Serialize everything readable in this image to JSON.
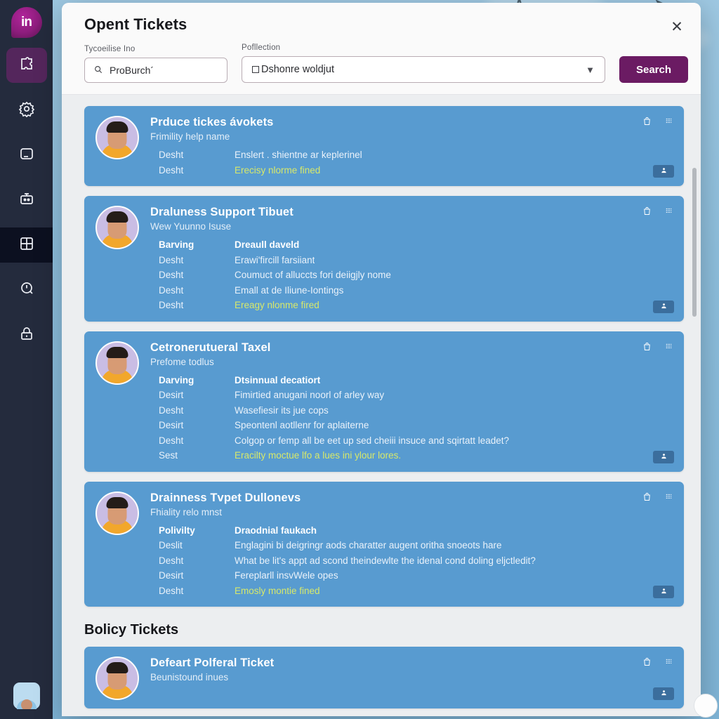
{
  "app": {
    "logo_text": "in",
    "logo_name": "app-logo"
  },
  "sidebar": {
    "items": [
      {
        "name": "puzzle-icon",
        "label": "Integrations"
      },
      {
        "name": "gear-icon",
        "label": "Settings"
      },
      {
        "name": "window-icon",
        "label": "Workspace"
      },
      {
        "name": "robot-icon",
        "label": "Bots"
      },
      {
        "name": "grid-icon",
        "label": "Dashboard"
      },
      {
        "name": "clock-icon",
        "label": "History"
      },
      {
        "name": "lock-icon",
        "label": "Security"
      }
    ],
    "avatar_name": "user-avatar"
  },
  "modal": {
    "title": "Opent Tickets",
    "close_label": "✕"
  },
  "search": {
    "query_label": "Tycoeilise Ino",
    "query_value": "ProBurch´",
    "query_placeholder": "ProBurch´",
    "filter_label": "Pofllection",
    "filter_value": "Dshonre woldjut",
    "filter_options": [
      "Dshonre woldjut"
    ],
    "button_label": "Search"
  },
  "sections": [
    {
      "heading": "",
      "tickets": [
        {
          "title": "Prduce tickes ávokets",
          "subtitle": "Frimility help name",
          "rows": [
            {
              "c1": "Desht",
              "c2": "Enslert . shientne ar keplerinel",
              "kind": "normal"
            },
            {
              "c1": "Desht",
              "c2": "Erecisy nlorme fined",
              "kind": "ok"
            }
          ]
        },
        {
          "title": "Draluness Support Tibuet",
          "subtitle": "Wew Yuunno Isuse",
          "rows": [
            {
              "c1": "Barving",
              "c2": "Dreaull daveld",
              "kind": "head"
            },
            {
              "c1": "Desht",
              "c2": "Erawi'fircill farsiiant",
              "kind": "normal"
            },
            {
              "c1": "Desht",
              "c2": "Coumuct of alluccts fori deiigjly nome",
              "kind": "normal"
            },
            {
              "c1": "Desht",
              "c2": "Emall at de Iliune-Iontings",
              "kind": "normal"
            },
            {
              "c1": "Desht",
              "c2": "Ereagy nlonme fired",
              "kind": "ok"
            }
          ]
        },
        {
          "title": "Cetronerutueral Taxel",
          "subtitle": "Prefome todlus",
          "rows": [
            {
              "c1": "Darving",
              "c2": "Dtsinnual decatiort",
              "kind": "head"
            },
            {
              "c1": "Desirt",
              "c2": "Fimirtied anugani noorl of arley way",
              "kind": "normal"
            },
            {
              "c1": "Desht",
              "c2": "Wasefiesir its jue cops",
              "kind": "normal"
            },
            {
              "c1": "Desirt",
              "c2": "Speontenl aotllenr for aplaiterne",
              "kind": "normal"
            },
            {
              "c1": "Desht",
              "c2": "Colgop or femp all be eet up sed cheiii insuce and sqirtatt leadet?",
              "kind": "normal"
            },
            {
              "c1": "Sest",
              "c2": "Eracilty moctue lfo a lues ini ylour lores.",
              "kind": "ok"
            }
          ]
        },
        {
          "title": "Drainness Tvpet Dullonevs",
          "subtitle": "Fhiality relo mnst",
          "rows": [
            {
              "c1": "Polivilty",
              "c2": "Draodnial faukach",
              "kind": "head"
            },
            {
              "c1": "Deslit",
              "c2": "Englagini bi deigringr aods charatter augent oritha snoeots hare",
              "kind": "normal"
            },
            {
              "c1": "Desht",
              "c2": "What be lit's appt ad scond theindewlte the idenal cond doling eljctledit?",
              "kind": "normal"
            },
            {
              "c1": "Desirt",
              "c2": "Fereplarll insvWele opes",
              "kind": "normal"
            },
            {
              "c1": "Desht",
              "c2": "Emosly montie fined",
              "kind": "ok"
            }
          ]
        }
      ]
    },
    {
      "heading": "Bolicy Tickets",
      "tickets": [
        {
          "title": "Defeart Polferal Ticket",
          "subtitle": "Beunistound inues",
          "rows": []
        }
      ]
    }
  ],
  "colors": {
    "brand_purple": "#6b1b63",
    "card_blue": "#589bd0",
    "accent_green": "#d7e86a",
    "sidebar_dark": "#242b3d"
  }
}
